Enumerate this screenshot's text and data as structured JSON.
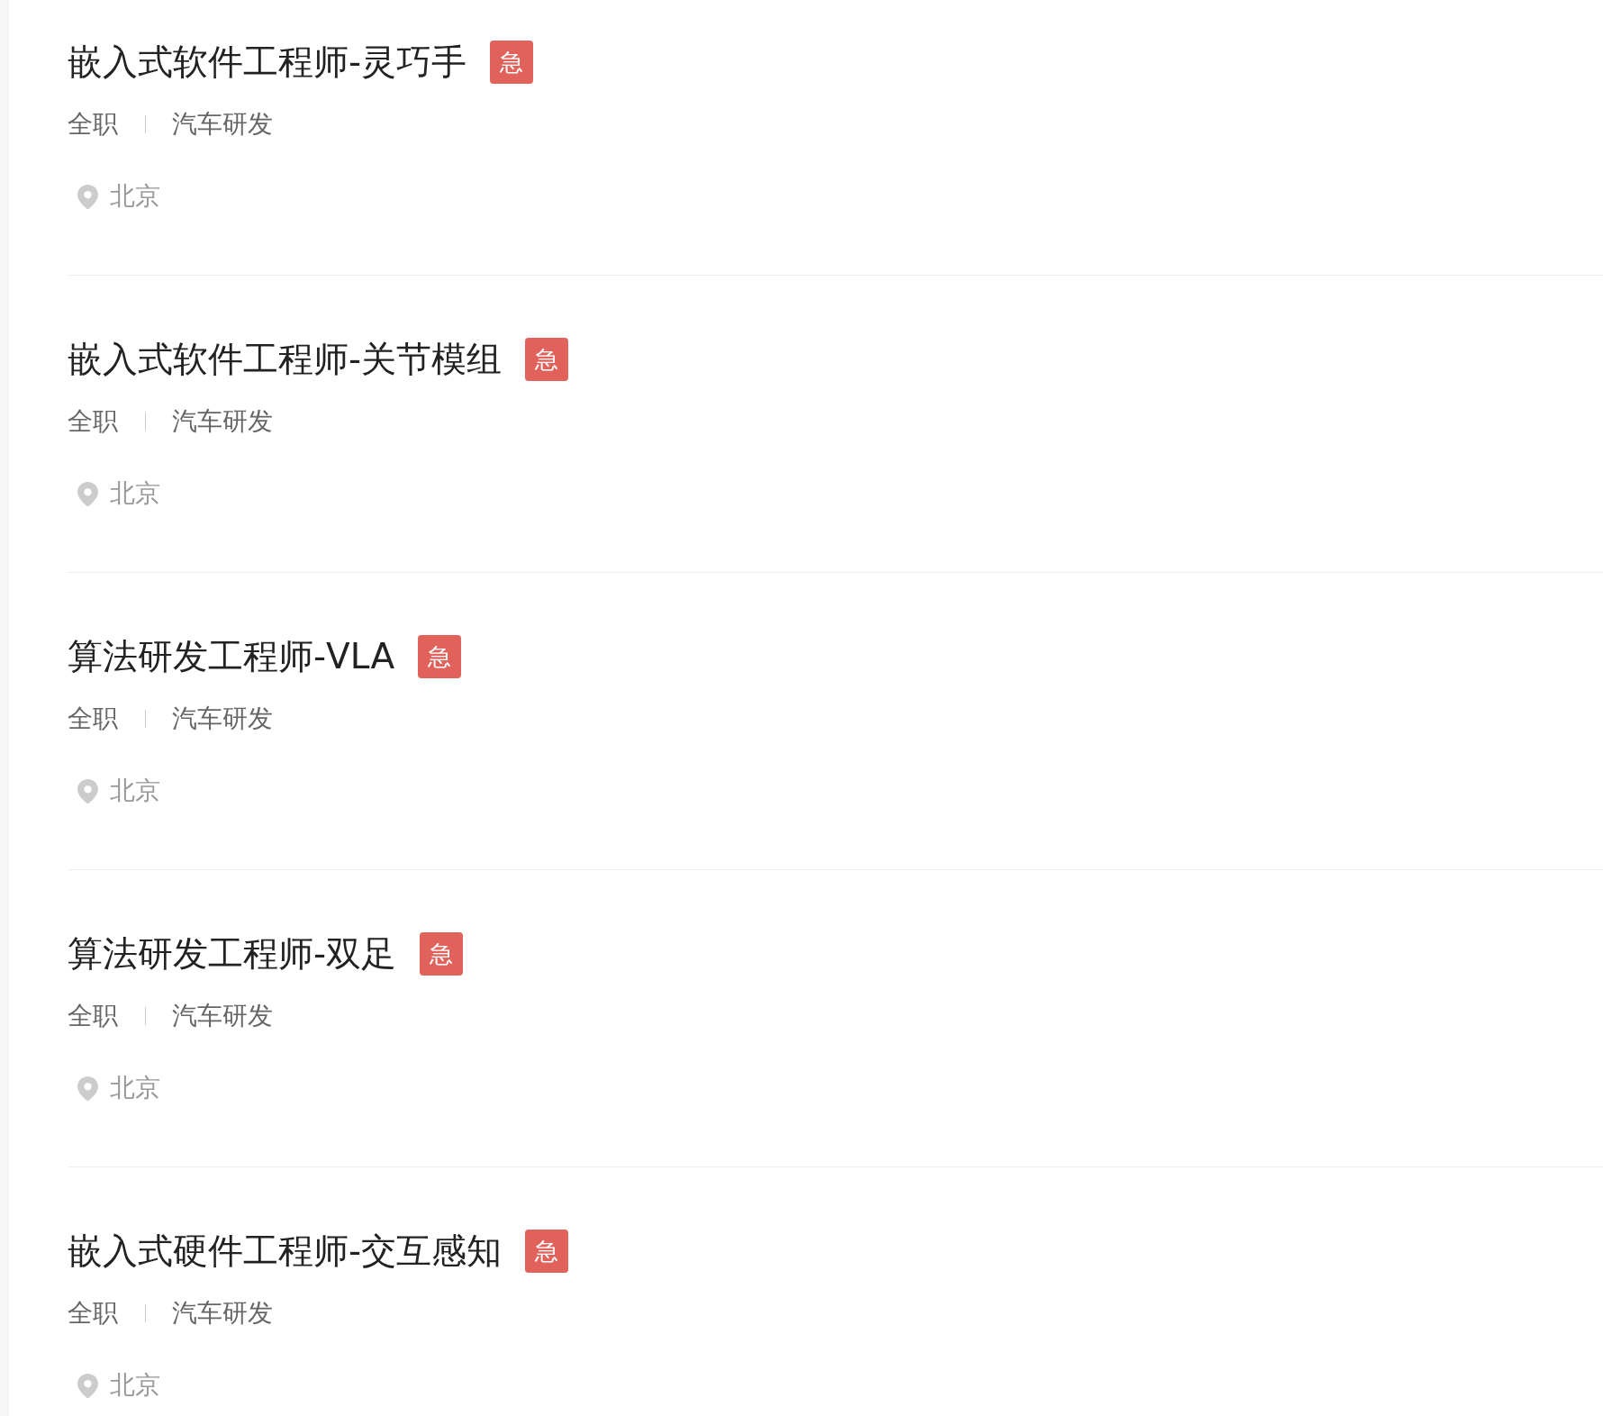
{
  "jobs": [
    {
      "title": "嵌入式软件工程师-灵巧手",
      "badge": "急",
      "employment_type": "全职",
      "category": "汽车研发",
      "location": "北京"
    },
    {
      "title": "嵌入式软件工程师-关节模组",
      "badge": "急",
      "employment_type": "全职",
      "category": "汽车研发",
      "location": "北京"
    },
    {
      "title": "算法研发工程师-VLA",
      "badge": "急",
      "employment_type": "全职",
      "category": "汽车研发",
      "location": "北京"
    },
    {
      "title": "算法研发工程师-双足",
      "badge": "急",
      "employment_type": "全职",
      "category": "汽车研发",
      "location": "北京"
    },
    {
      "title": "嵌入式硬件工程师-交互感知",
      "badge": "急",
      "employment_type": "全职",
      "category": "汽车研发",
      "location": "北京"
    }
  ]
}
